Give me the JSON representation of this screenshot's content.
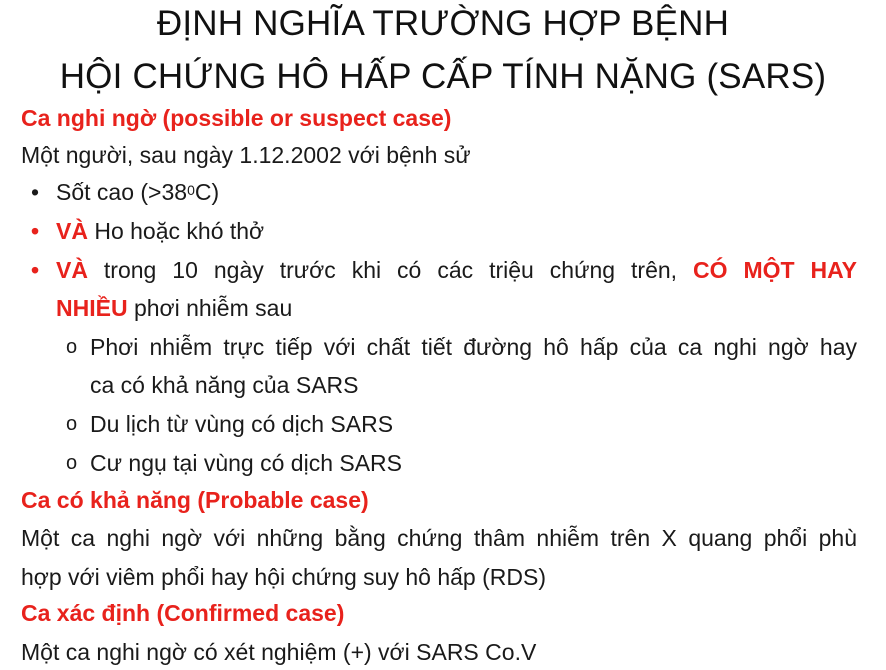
{
  "title": {
    "line1": "ĐỊNH NGHĨA TRƯỜNG HỢP BỆNH",
    "line2": "HỘI CHỨNG HÔ HẤP CẤP TÍNH NẶNG (SARS)"
  },
  "suspect": {
    "heading": "Ca nghi ngờ (possible or suspect case)",
    "intro": "Một người, sau ngày 1.12.2002 với bệnh sử",
    "fever_pre": "Sốt cao (>38",
    "fever_sup": "0",
    "fever_post": "C)",
    "and_label": "VÀ",
    "cough_text": " Ho hoặc khó thở",
    "exposure_text": " trong 10 ngày trước khi có các triệu chứng trên, ",
    "one_or_more_line1": "CÓ MỘT HAY",
    "one_or_more_line2": "NHIỀU",
    "exposure_after": " phơi nhiễm sau",
    "sub1_line1": "Phơi nhiễm trực tiếp với chất tiết đường hô hấp của ca nghi ngờ hay",
    "sub1_line2": "ca có khả năng của  SARS",
    "sub2": "Du lịch từ vùng có dịch SARS",
    "sub3": "Cư ngụ tại vùng có dịch SARS"
  },
  "probable": {
    "heading": "Ca có khả năng (Probable case)",
    "line1": "Một ca nghi ngờ với những bằng chứng thâm nhiễm trên X quang phổi phù",
    "line2": "hợp với viêm phổi hay hội chứng suy hô hấp (RDS)"
  },
  "confirmed": {
    "heading": "Ca xác định (Confirmed case)",
    "line1": "Một ca nghi ngờ có xét nghiệm (+) với SARS Co.V"
  },
  "markers": {
    "bullet": "•",
    "circle": "o"
  },
  "colors": {
    "accent_red": "#e8221c",
    "text": "#1a1a1a"
  }
}
